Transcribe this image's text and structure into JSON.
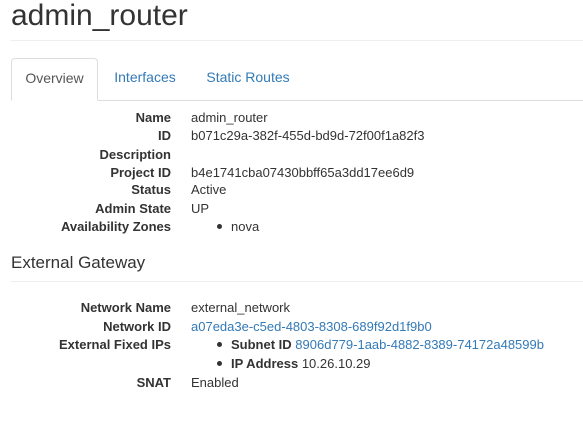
{
  "page": {
    "title": "admin_router"
  },
  "tabs": [
    {
      "label": "Overview",
      "active": true
    },
    {
      "label": "Interfaces",
      "active": false
    },
    {
      "label": "Static Routes",
      "active": false
    }
  ],
  "overview": {
    "name_label": "Name",
    "name_value": "admin_router",
    "id_label": "ID",
    "id_value": "b071c29a-382f-455d-bd9d-72f00f1a82f3",
    "description_label": "Description",
    "description_value": "",
    "project_id_label": "Project ID",
    "project_id_value": "b4e1741cba07430bbff65a3dd17ee6d9",
    "status_label": "Status",
    "status_value": "Active",
    "admin_state_label": "Admin State",
    "admin_state_value": "UP",
    "availability_zones_label": "Availability Zones",
    "availability_zones": [
      "nova"
    ]
  },
  "external_gateway": {
    "title": "External Gateway",
    "network_name_label": "Network Name",
    "network_name_value": "external_network",
    "network_id_label": "Network ID",
    "network_id_value": "a07eda3e-c5ed-4803-8308-689f92d1f9b0",
    "fixed_ips_label": "External Fixed IPs",
    "subnet_id_label": "Subnet ID",
    "subnet_id_value": "8906d779-1aab-4882-8389-74172a48599b",
    "ip_address_label": "IP Address",
    "ip_address_value": "10.26.10.29",
    "snat_label": "SNAT",
    "snat_value": "Enabled"
  },
  "colors": {
    "link": "#337ab7",
    "text": "#333333",
    "border": "#dddddd"
  }
}
